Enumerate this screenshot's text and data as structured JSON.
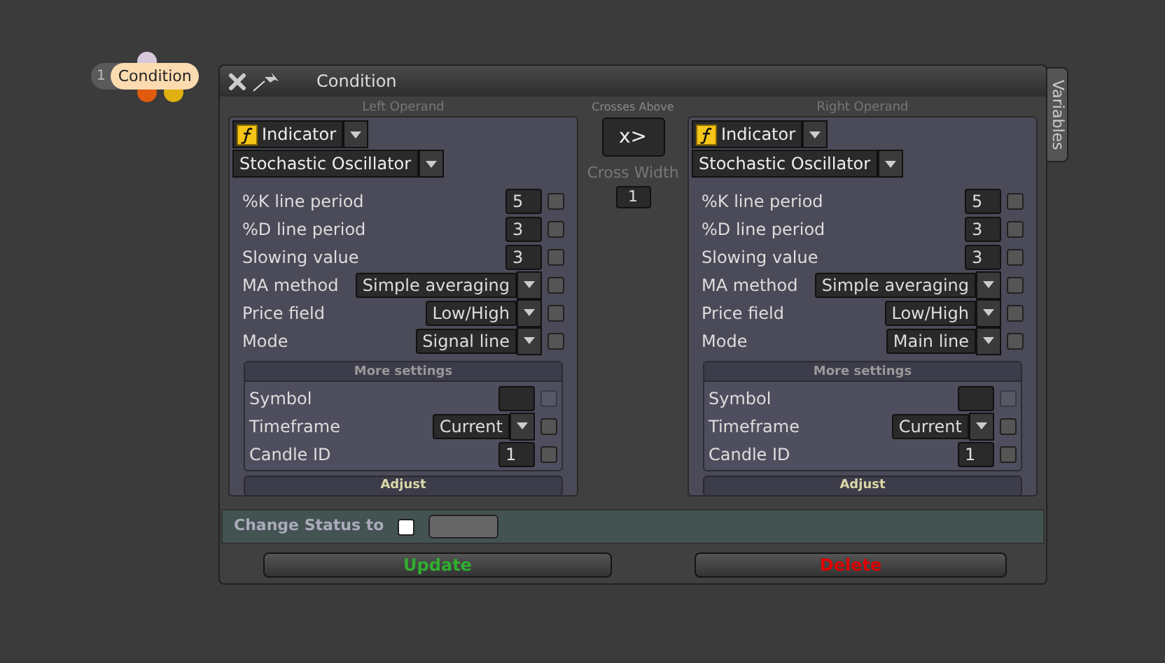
{
  "node": {
    "number": "1",
    "label": "Condition"
  },
  "dialog": {
    "title": "Condition",
    "side_tab": "Variables"
  },
  "operands": [
    {
      "heading": "Left Operand",
      "source": "Indicator",
      "indicator": "Stochastic Oscillator",
      "params": [
        {
          "kind": "number",
          "label": "%K line period",
          "value": "5",
          "checked": false
        },
        {
          "kind": "number",
          "label": "%D line period",
          "value": "3",
          "checked": false
        },
        {
          "kind": "number",
          "label": "Slowing value",
          "value": "3",
          "checked": false
        },
        {
          "kind": "select",
          "label": "MA method",
          "value": "Simple averaging",
          "checked": false
        },
        {
          "kind": "select",
          "label": "Price field",
          "value": "Low/High",
          "checked": false
        },
        {
          "kind": "select",
          "label": "Mode",
          "value": "Signal line",
          "checked": false
        }
      ],
      "more_settings": "More settings",
      "more": [
        {
          "kind": "number",
          "label": "Symbol",
          "checked": false,
          "disabled": true
        },
        {
          "kind": "select",
          "label": "Timeframe",
          "value": "Current",
          "checked": false,
          "disabled": false
        },
        {
          "kind": "number",
          "label": "Candle ID",
          "value": "1",
          "checked": false,
          "disabled": false
        }
      ],
      "adjust": "Adjust"
    },
    {
      "heading": "Right Operand",
      "source": "Indicator",
      "indicator": "Stochastic Oscillator",
      "params": [
        {
          "kind": "number",
          "label": "%K line period",
          "value": "5",
          "checked": false
        },
        {
          "kind": "number",
          "label": "%D line period",
          "value": "3",
          "checked": false
        },
        {
          "kind": "number",
          "label": "Slowing value",
          "value": "3",
          "checked": false
        },
        {
          "kind": "select",
          "label": "MA method",
          "value": "Simple averaging",
          "checked": false
        },
        {
          "kind": "select",
          "label": "Price field",
          "value": "Low/High",
          "checked": false
        },
        {
          "kind": "select",
          "label": "Mode",
          "value": "Main line",
          "checked": false
        }
      ],
      "more_settings": "More settings",
      "more": [
        {
          "kind": "number",
          "label": "Symbol",
          "checked": false,
          "disabled": true
        },
        {
          "kind": "select",
          "label": "Timeframe",
          "value": "Current",
          "checked": false,
          "disabled": false
        },
        {
          "kind": "number",
          "label": "Candle ID",
          "value": "1",
          "checked": false,
          "disabled": false
        }
      ],
      "adjust": "Adjust"
    }
  ],
  "operator": {
    "caption": "Crosses Above",
    "symbol": "x>",
    "width_label": "Cross Width",
    "width_value": "1"
  },
  "status": {
    "label": "Change Status to",
    "checked": false
  },
  "buttons": [
    {
      "kind": "update",
      "label": "Update"
    },
    {
      "kind": "delete",
      "label": "Delete"
    }
  ]
}
